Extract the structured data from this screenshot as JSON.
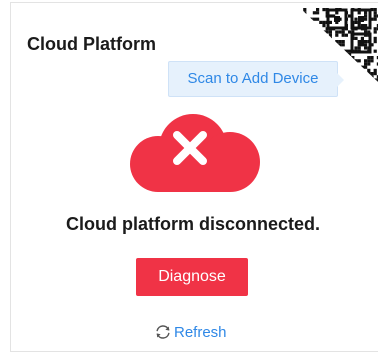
{
  "panel": {
    "title": "Cloud Platform"
  },
  "qr": {
    "icon": "qr-code-icon"
  },
  "tooltip": {
    "text": "Scan to Add Device"
  },
  "status": {
    "icon": "cloud-error-icon",
    "message": "Cloud platform disconnected."
  },
  "actions": {
    "diagnose_label": "Diagnose",
    "refresh_label": "Refresh",
    "refresh_icon": "refresh-icon"
  },
  "colors": {
    "error_red": "#f03346",
    "link_blue": "#2f88e6",
    "tooltip_bg": "#e6f1fc"
  }
}
